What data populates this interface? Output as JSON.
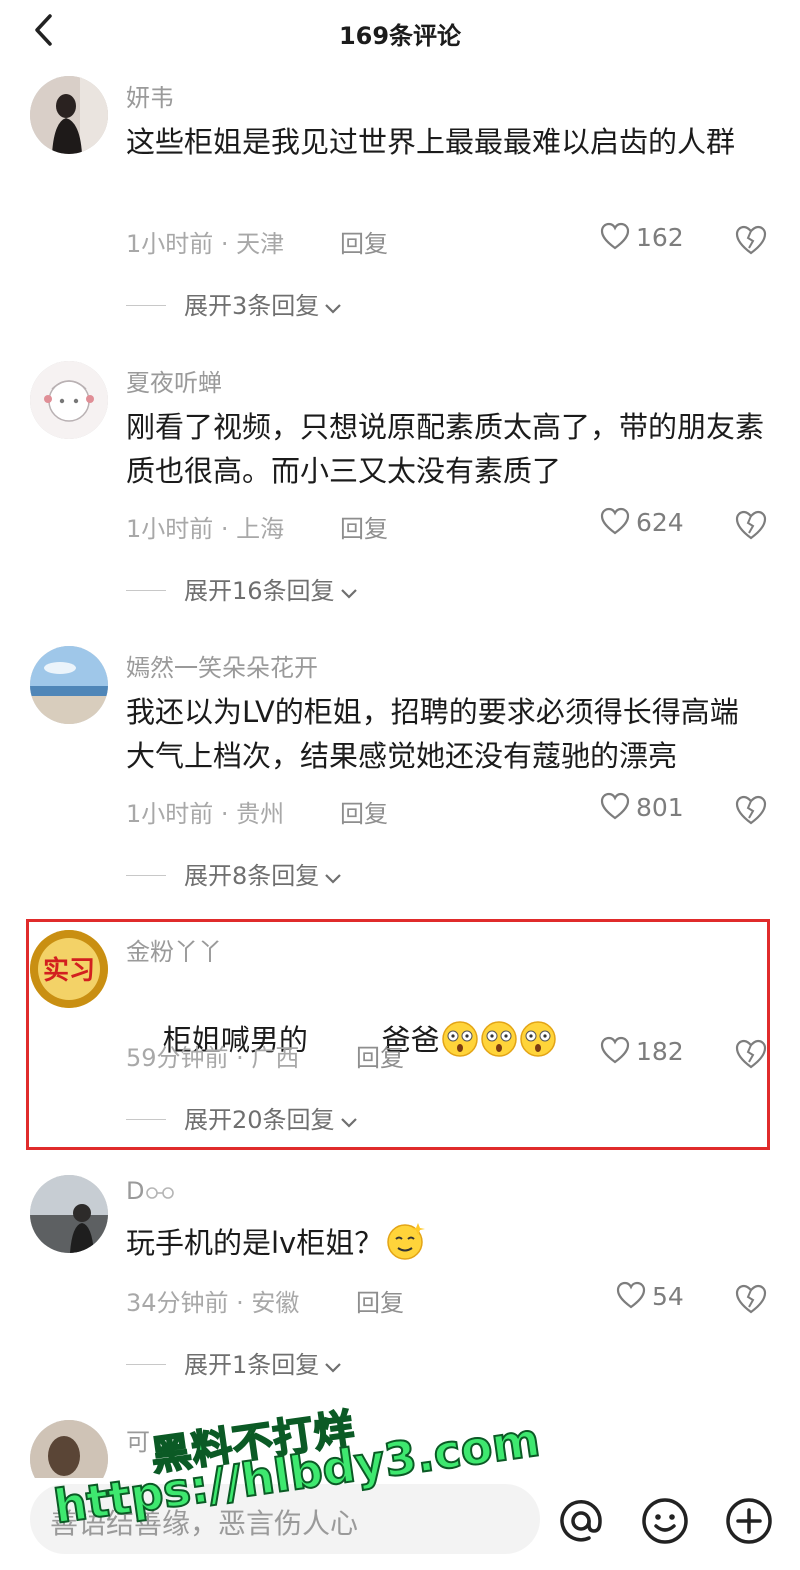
{
  "header": {
    "title": "169条评论"
  },
  "comments": [
    {
      "user": "妍韦",
      "text": "这些柜姐是我见过世界上最最最难以启齿的人群",
      "time": "1小时前 · 天津",
      "reply": "回复",
      "likes": "162",
      "expand": "展开3条回复"
    },
    {
      "user": "夏夜听蝉",
      "text": "刚看了视频，只想说原配素质太高了，带的朋友素质也很高。而小三又太没有素质了",
      "time": "1小时前 · 上海",
      "reply": "回复",
      "likes": "624",
      "expand": "展开16条回复"
    },
    {
      "user": "嫣然一笑朵朵花开",
      "text": "我还以为LV的柜姐，招聘的要求必须得长得高端大气上档次，结果感觉她还没有蔻驰的漂亮",
      "time": "1小时前 · 贵州",
      "reply": "回复",
      "likes": "801",
      "expand": "展开8条回复"
    },
    {
      "user": "金粉丫丫",
      "text": "柜姐喊男的        爸爸",
      "time": "59分钟前 · 广西",
      "reply": "回复",
      "likes": "182",
      "expand": "展开20条回复",
      "avatar_text": "实习"
    },
    {
      "user": "D",
      "text": "玩手机的是lv柜姐？",
      "time": "34分钟前 · 安徽",
      "reply": "回复",
      "likes": "54",
      "expand": "展开1条回复"
    },
    {
      "user": "可"
    }
  ],
  "input": {
    "placeholder": "善语结善缘，恶言伤人心"
  },
  "watermark": {
    "line1": "黑料不打烊",
    "line2": "https://hlbdy3.com"
  },
  "colors": {
    "highlight_border": "#e02b2b",
    "watermark": "#3ee86f"
  }
}
